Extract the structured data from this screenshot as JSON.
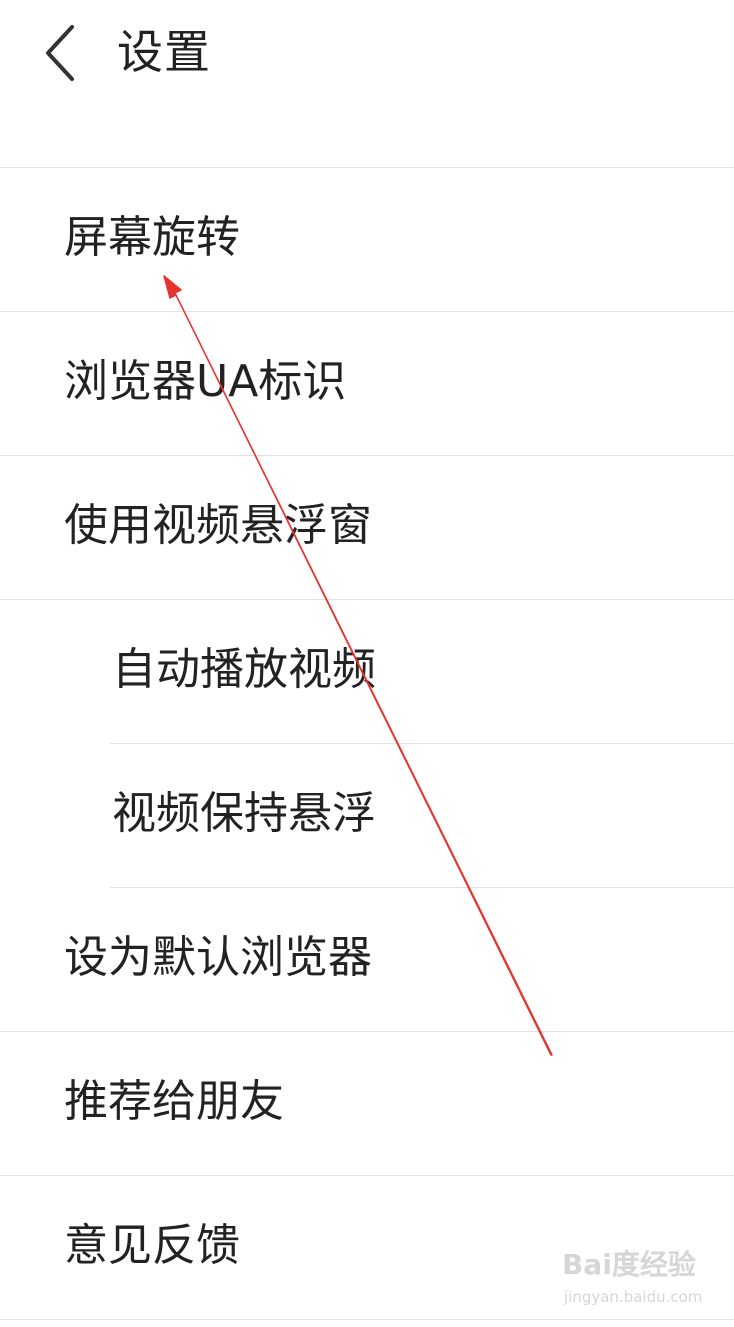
{
  "header": {
    "title": "设置",
    "back_icon": "chevron-left-icon"
  },
  "settings": {
    "items": [
      {
        "label": "屏幕旋转"
      },
      {
        "label": "浏览器UA标识"
      },
      {
        "label": "使用视频悬浮窗"
      },
      {
        "label": "自动播放视频"
      },
      {
        "label": "视频保持悬浮"
      },
      {
        "label": "设为默认浏览器"
      },
      {
        "label": "推荐给朋友"
      },
      {
        "label": "意见反馈"
      }
    ]
  },
  "annotation": {
    "color": "#e8322d"
  },
  "watermark": {
    "brand": "Bai度经验",
    "url": "jingyan.baidu.com"
  },
  "colors": {
    "background": "#ffffff",
    "text": "#222222",
    "divider": "#e2e2e2"
  }
}
